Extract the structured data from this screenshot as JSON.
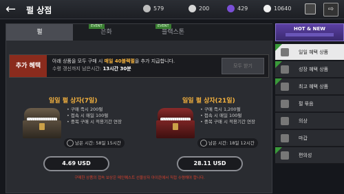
{
  "header": {
    "back_icon": "arrow-left-icon",
    "title": "펄 상점",
    "currencies": [
      {
        "icon": "silver-icon",
        "value": "579",
        "color": "#bdbdbd"
      },
      {
        "icon": "coin-icon",
        "value": "200",
        "color": "#d6d6d6"
      },
      {
        "icon": "black-pearl-icon",
        "value": "429",
        "color": "#7a4fd6"
      },
      {
        "icon": "pearl-icon",
        "value": "10640",
        "color": "#f0f0f0"
      }
    ]
  },
  "tabs": [
    {
      "label": "펄",
      "event": "",
      "active": true
    },
    {
      "label": "은화",
      "event": "EVENT",
      "active": false
    },
    {
      "label": "",
      "event": "",
      "active": false
    },
    {
      "label": "블랙스톤",
      "event": "EVENT",
      "active": false
    }
  ],
  "bonus": {
    "label": "추가 혜택",
    "line1_pre": "아래 상품을 모두 구매 시 ",
    "line1_hl": "매일 40블랙펄",
    "line1_post": "을 추가 지급합니다.",
    "line2_pre": "수령 갱신까지 남은시간: ",
    "line2_val": "13시간 30분",
    "button": "모두 받기"
  },
  "packs": [
    {
      "title": "일일 펄 상자(7일)",
      "lines": [
        "구매 즉시 200펄",
        "접속 시 매일 100펄",
        "중복 구매 시 적용기간 연장"
      ],
      "timer": "남은 시간: 58일 15시간",
      "price": "4.69 USD"
    },
    {
      "title": "일일 펄 상자(21일)",
      "lines": [
        "구매 즉시 1,200펄",
        "접속 시 매일 100펄",
        "중복 구매 시 적용기간 연장"
      ],
      "timer": "남은 시간: 18일 12시간",
      "price": "28.11 USD"
    }
  ],
  "notice": "구매한 상품의 접속 보상은 메인퀘스트 선물상자 아이콘에서 직접 수령해야 합니다.",
  "sidebar": {
    "hot": "HOT & NEW",
    "items": [
      {
        "label": "일일 혜택 상품",
        "icon": "gift-icon",
        "active": true
      },
      {
        "label": "성장 혜택 상품",
        "icon": "growth-icon",
        "active": false
      },
      {
        "label": "최고 혜택 상품",
        "icon": "crown-icon",
        "active": false
      },
      {
        "label": "펄 묶음",
        "icon": "pearl-bundle-icon",
        "active": false
      },
      {
        "label": "의상",
        "icon": "costume-icon",
        "active": false
      },
      {
        "label": "마갑",
        "icon": "horse-icon",
        "active": false
      },
      {
        "label": "편의성",
        "icon": "convenience-icon",
        "active": false
      }
    ]
  },
  "colors": {
    "accent": "#f5b23e",
    "event": "#3a7f32",
    "bonus_label": "#8a2b1d",
    "notice": "#d9412e"
  }
}
